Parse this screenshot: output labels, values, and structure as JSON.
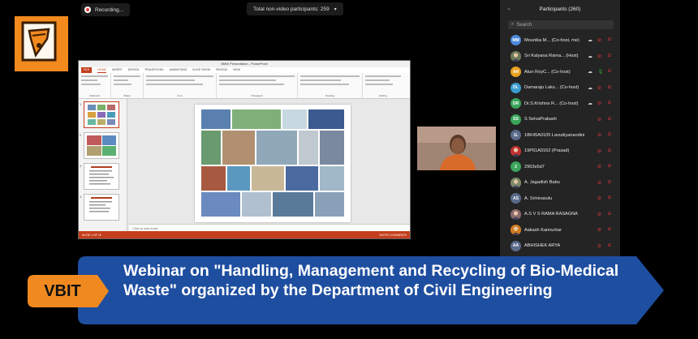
{
  "recording": {
    "label": "Recording..."
  },
  "top_bar": {
    "non_video_label": "Total non-video participants: 259"
  },
  "powerpoint": {
    "window_title": "BMW Presentation - PowerPoint",
    "tabs": [
      "FILE",
      "HOME",
      "INSERT",
      "DESIGN",
      "TRANSITIONS",
      "ANIMATIONS",
      "SLIDE SHOW",
      "REVIEW",
      "VIEW"
    ],
    "ribbon_groups": [
      "Clipboard",
      "Slides",
      "Font",
      "Paragraph",
      "Drawing",
      "Editing"
    ],
    "slide_numbers": [
      "1",
      "2",
      "3",
      "4"
    ],
    "notes_placeholder": "Click to add notes",
    "status_left": "SLIDE 1 OF 15",
    "status_right": "NOTES  COMMENTS"
  },
  "participants": {
    "title": "Participants (260)",
    "search_placeholder": "Search",
    "list": [
      {
        "initials": "MM",
        "name": "Mounika M...  (Co-host, me)",
        "color": "#4a8ad8",
        "avatar": "initials",
        "cloud": true,
        "mic": "muted",
        "cam": "off"
      },
      {
        "initials": "",
        "name": "Sri Kalyana Rama...   (Host)",
        "color": "#6a7a5a",
        "avatar": "photo",
        "cloud": true,
        "mic": "muted",
        "cam": "off"
      },
      {
        "initials": "AR",
        "name": "Atun RoyC...   (Co-host)",
        "color": "#e8a020",
        "avatar": "initials",
        "cloud": true,
        "mic": "on",
        "cam": "off"
      },
      {
        "initials": "DL",
        "name": "Damaraju Laks...   (Co-host)",
        "color": "#3a9ad0",
        "avatar": "initials",
        "cloud": true,
        "mic": "muted",
        "cam": "off"
      },
      {
        "initials": "DR",
        "name": "Dr.S.Krishna R...  (Co-host)",
        "color": "#3aa55a",
        "avatar": "initials",
        "cloud": true,
        "mic": "muted",
        "cam": "off"
      },
      {
        "initials": "SS",
        "name": "S SelvaPrakash",
        "color": "#3aa55a",
        "avatar": "initials",
        "cloud": false,
        "mic": "muted",
        "cam": "off"
      },
      {
        "initials": "1L",
        "name": "18K45A0105 Lavudiyanandini",
        "color": "#5a6a8a",
        "avatar": "initials",
        "cloud": false,
        "mic": "muted",
        "cam": "off"
      },
      {
        "initials": "",
        "name": "19P61A0162 (Prasad)",
        "color": "#c03030",
        "avatar": "photo",
        "cloud": false,
        "mic": "muted",
        "cam": "off"
      },
      {
        "initials": "2",
        "name": "2963e5d7",
        "color": "#3aa55a",
        "avatar": "initials",
        "cloud": false,
        "mic": "muted",
        "cam": "off"
      },
      {
        "initials": "",
        "name": "A. Jagadish Babu",
        "color": "#7a8a6a",
        "avatar": "photo",
        "cloud": false,
        "mic": "muted",
        "cam": "off"
      },
      {
        "initials": "AS",
        "name": "A. Srinivasulu",
        "color": "#5a6a8a",
        "avatar": "initials",
        "cloud": false,
        "mic": "muted",
        "cam": "off"
      },
      {
        "initials": "",
        "name": "A.S V S RAMA RASAGNA",
        "color": "#8a6a6a",
        "avatar": "photo",
        "cloud": false,
        "mic": "muted",
        "cam": "off"
      },
      {
        "initials": "",
        "name": "Aakash Kannurkar",
        "color": "#d07a20",
        "avatar": "photo",
        "cloud": false,
        "mic": "muted",
        "cam": "off"
      },
      {
        "initials": "AA",
        "name": "ABHISHEK ARYA",
        "color": "#5a6a8a",
        "avatar": "initials",
        "cloud": false,
        "mic": "muted",
        "cam": "off"
      }
    ]
  },
  "banner": {
    "tag": "VBIT",
    "text": "Webinar on \"Handling, Management and Recycling of Bio-Medical Waste\" organized by the Department of Civil Engineering",
    "color": "#1e4ea0",
    "tag_color": "#f08a20"
  },
  "logo_colors": {
    "primary": "#f28a1e",
    "ink": "#3a1e00"
  }
}
